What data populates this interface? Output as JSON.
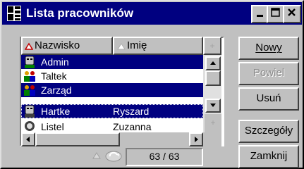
{
  "window": {
    "title": "Lista pracowników"
  },
  "grid": {
    "columns": [
      "Nazwisko",
      "Imię"
    ],
    "rows": [
      {
        "name": "Admin",
        "first": "",
        "selected": true,
        "icon": "person-icon"
      },
      {
        "name": "Taltek",
        "first": "",
        "selected": false,
        "icon": "group-icon"
      },
      {
        "name": "Zarząd",
        "first": "",
        "selected": true,
        "icon": "group-icon"
      },
      {
        "name": "Hartke",
        "first": "Ryszard",
        "selected": true,
        "icon": "person-icon"
      },
      {
        "name": "Listel",
        "first": "Zuzanna",
        "selected": false,
        "icon": "person-icon"
      }
    ]
  },
  "footer": {
    "counter": "63 / 63"
  },
  "buttons": {
    "new": "Nowy",
    "repeat": "Powiel",
    "delete": "Usuń",
    "details": "Szczegóły",
    "close": "Zamknij"
  },
  "colors": {
    "titlebar": "#000080",
    "selection": "#000080",
    "face": "#c0c0c0"
  }
}
